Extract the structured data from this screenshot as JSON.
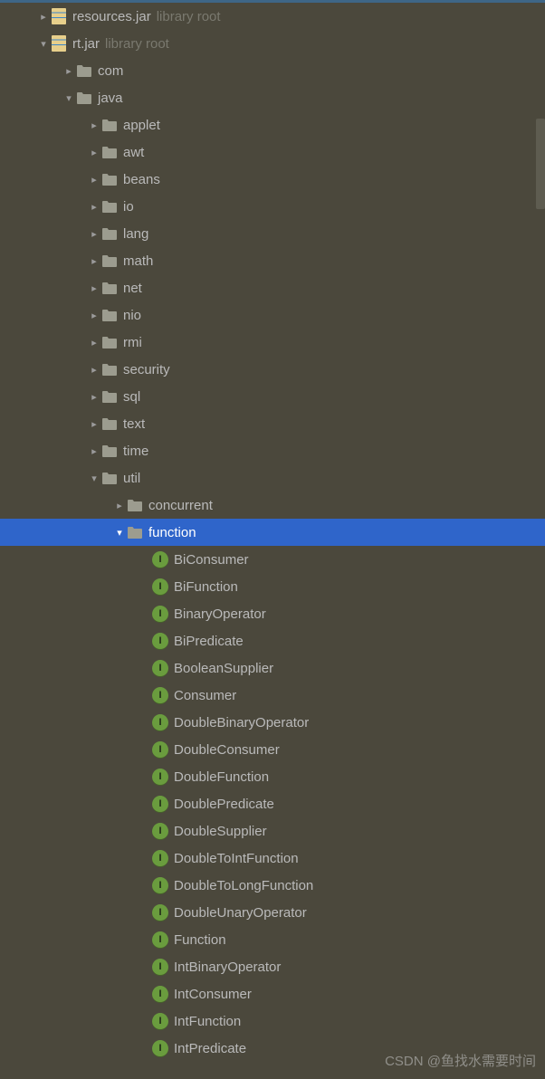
{
  "suffix_library_root": "library root",
  "interface_letter": "I",
  "watermark": "CSDN @鱼找水需要时间",
  "tree": [
    {
      "depth": 0,
      "chev": "closed",
      "icon": "jar",
      "label": "resources.jar",
      "suffix": true
    },
    {
      "depth": 0,
      "chev": "open",
      "icon": "jar",
      "label": "rt.jar",
      "suffix": true
    },
    {
      "depth": 1,
      "chev": "closed",
      "icon": "folder",
      "label": "com"
    },
    {
      "depth": 1,
      "chev": "open",
      "icon": "folder",
      "label": "java"
    },
    {
      "depth": 2,
      "chev": "closed",
      "icon": "folder",
      "label": "applet"
    },
    {
      "depth": 2,
      "chev": "closed",
      "icon": "folder",
      "label": "awt"
    },
    {
      "depth": 2,
      "chev": "closed",
      "icon": "folder",
      "label": "beans"
    },
    {
      "depth": 2,
      "chev": "closed",
      "icon": "folder",
      "label": "io"
    },
    {
      "depth": 2,
      "chev": "closed",
      "icon": "folder",
      "label": "lang"
    },
    {
      "depth": 2,
      "chev": "closed",
      "icon": "folder",
      "label": "math"
    },
    {
      "depth": 2,
      "chev": "closed",
      "icon": "folder",
      "label": "net"
    },
    {
      "depth": 2,
      "chev": "closed",
      "icon": "folder",
      "label": "nio"
    },
    {
      "depth": 2,
      "chev": "closed",
      "icon": "folder",
      "label": "rmi"
    },
    {
      "depth": 2,
      "chev": "closed",
      "icon": "folder",
      "label": "security"
    },
    {
      "depth": 2,
      "chev": "closed",
      "icon": "folder",
      "label": "sql"
    },
    {
      "depth": 2,
      "chev": "closed",
      "icon": "folder",
      "label": "text"
    },
    {
      "depth": 2,
      "chev": "closed",
      "icon": "folder",
      "label": "time"
    },
    {
      "depth": 2,
      "chev": "open",
      "icon": "folder",
      "label": "util"
    },
    {
      "depth": 3,
      "chev": "closed",
      "icon": "folder",
      "label": "concurrent"
    },
    {
      "depth": 3,
      "chev": "open",
      "icon": "folder",
      "label": "function",
      "selected": true
    },
    {
      "depth": 4,
      "chev": "none",
      "icon": "interface",
      "label": "BiConsumer"
    },
    {
      "depth": 4,
      "chev": "none",
      "icon": "interface",
      "label": "BiFunction"
    },
    {
      "depth": 4,
      "chev": "none",
      "icon": "interface",
      "label": "BinaryOperator"
    },
    {
      "depth": 4,
      "chev": "none",
      "icon": "interface",
      "label": "BiPredicate"
    },
    {
      "depth": 4,
      "chev": "none",
      "icon": "interface",
      "label": "BooleanSupplier"
    },
    {
      "depth": 4,
      "chev": "none",
      "icon": "interface",
      "label": "Consumer"
    },
    {
      "depth": 4,
      "chev": "none",
      "icon": "interface",
      "label": "DoubleBinaryOperator"
    },
    {
      "depth": 4,
      "chev": "none",
      "icon": "interface",
      "label": "DoubleConsumer"
    },
    {
      "depth": 4,
      "chev": "none",
      "icon": "interface",
      "label": "DoubleFunction"
    },
    {
      "depth": 4,
      "chev": "none",
      "icon": "interface",
      "label": "DoublePredicate"
    },
    {
      "depth": 4,
      "chev": "none",
      "icon": "interface",
      "label": "DoubleSupplier"
    },
    {
      "depth": 4,
      "chev": "none",
      "icon": "interface",
      "label": "DoubleToIntFunction"
    },
    {
      "depth": 4,
      "chev": "none",
      "icon": "interface",
      "label": "DoubleToLongFunction"
    },
    {
      "depth": 4,
      "chev": "none",
      "icon": "interface",
      "label": "DoubleUnaryOperator"
    },
    {
      "depth": 4,
      "chev": "none",
      "icon": "interface",
      "label": "Function"
    },
    {
      "depth": 4,
      "chev": "none",
      "icon": "interface",
      "label": "IntBinaryOperator"
    },
    {
      "depth": 4,
      "chev": "none",
      "icon": "interface",
      "label": "IntConsumer"
    },
    {
      "depth": 4,
      "chev": "none",
      "icon": "interface",
      "label": "IntFunction"
    },
    {
      "depth": 4,
      "chev": "none",
      "icon": "interface",
      "label": "IntPredicate"
    }
  ]
}
